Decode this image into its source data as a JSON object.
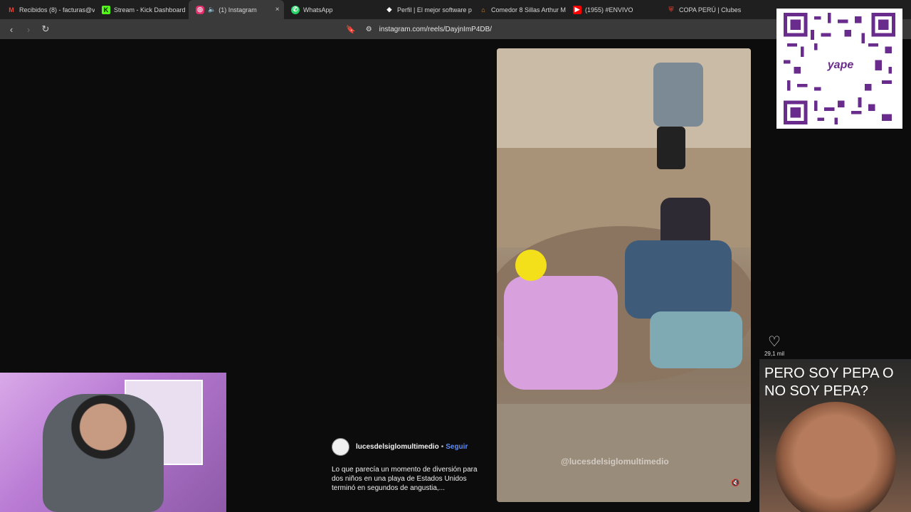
{
  "tabs": [
    {
      "label": "Recibidos (8) - facturas@v",
      "icon": "gmail-icon",
      "color": "#ea4335"
    },
    {
      "label": "Stream - Kick Dashboard",
      "icon": "kick-icon",
      "color": "#53fc18"
    },
    {
      "label": "(1) Instagram",
      "icon": "instagram-icon",
      "color": "#e1306c",
      "active": true
    },
    {
      "label": "WhatsApp",
      "icon": "whatsapp-icon",
      "color": "#25d366"
    },
    {
      "label": "Perfil | El mejor software p",
      "icon": "diamond-icon",
      "color": "#ffffff"
    },
    {
      "label": "Comedor 8 Sillas Arthur M",
      "icon": "home-icon",
      "color": "#f08a24"
    },
    {
      "label": "(1955) #ENVIVO",
      "icon": "youtube-icon",
      "color": "#ff0000"
    },
    {
      "label": "COPA PERÚ | Clubes",
      "icon": "shield-icon",
      "color": "#c0392b"
    }
  ],
  "tab_close": "×",
  "toolbar": {
    "url": "instagram.com/reels/DayjnImP4DB/"
  },
  "reel": {
    "watermark": "@lucesdelsiglomultimedio",
    "likes": "29,1 mil",
    "author": "lucesdelsiglomultimedio",
    "separator": "•",
    "follow": "Seguir",
    "caption": "Lo que parecía un momento de diversión para dos niños en una playa de Estados Unidos terminó en segundos de angustia,..."
  },
  "qr": {
    "brand": "yape"
  },
  "meme": {
    "text": "PERO SOY PEPA O NO SOY PEPA?"
  }
}
